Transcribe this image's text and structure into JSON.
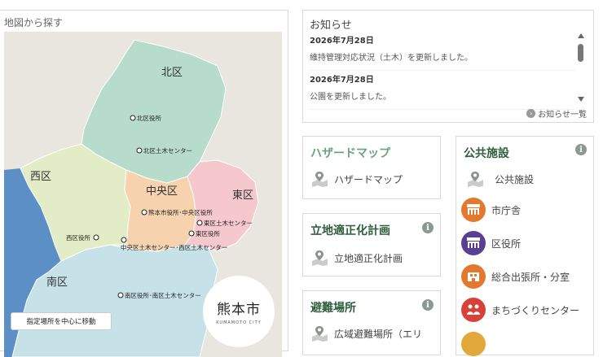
{
  "map_panel": {
    "title": "地図から探す",
    "districts": {
      "kita": "北区",
      "nishi": "西区",
      "chuo": "中央区",
      "higashi": "東区",
      "minami": "南区"
    },
    "pois": {
      "kita_office": "北区役所",
      "kita_civil": "北区土木センター",
      "city_hall": "熊本市役所･中央区役所",
      "higashi_civil": "東区土木センター",
      "higashi_office": "東区役所",
      "nishi_office": "西区役所",
      "chuo_nishi_civil": "中央区土木センター･西区土木センター",
      "minami_office": "南区役所･南区土木センター"
    },
    "move_button": "指定場所を中心に移動",
    "city_badge": {
      "name": "熊本市",
      "sub": "KUMAMOTO CITY"
    },
    "colors": {
      "kita": "#b8dccb",
      "nishi": "#e2ecc7",
      "chuo": "#f6d2ae",
      "higashi": "#f4c8cc",
      "minami": "#c6e2e8",
      "sea": "#5b8fc6",
      "land": "#e8e6df"
    }
  },
  "notices": {
    "title": "お知らせ",
    "items": [
      {
        "date": "2026年7月28日",
        "text": "維持管理対応状況（土木）を更新しました。"
      },
      {
        "date": "2026年7月28日",
        "text": "公園を更新しました。"
      }
    ],
    "more_link": "お知らせ一覧"
  },
  "cards": {
    "hazard": {
      "title": "ハザードマップ",
      "item": "ハザードマップ",
      "color": "#6aa37c"
    },
    "location": {
      "title": "立地適正化計画",
      "item": "立地適正化計画",
      "color": "#2f5e3c"
    },
    "evacuation": {
      "title": "避難場所",
      "item": "広域避難場所（エリ",
      "color": "#2f5e3c"
    },
    "public": {
      "title": "公共施設",
      "color": "#2f5e3c",
      "items": [
        {
          "label": "公共施設",
          "icon": "map-pin-icon"
        },
        {
          "label": "市庁舎",
          "icon": "city-hall-icon",
          "color": "#e3782e"
        },
        {
          "label": "区役所",
          "icon": "ward-office-icon",
          "color": "#5a3f94"
        },
        {
          "label": "総合出張所・分室",
          "icon": "branch-office-icon",
          "color": "#e3782e"
        },
        {
          "label": "まちづくりセンター",
          "icon": "community-center-icon",
          "color": "#d8413a"
        }
      ]
    }
  }
}
